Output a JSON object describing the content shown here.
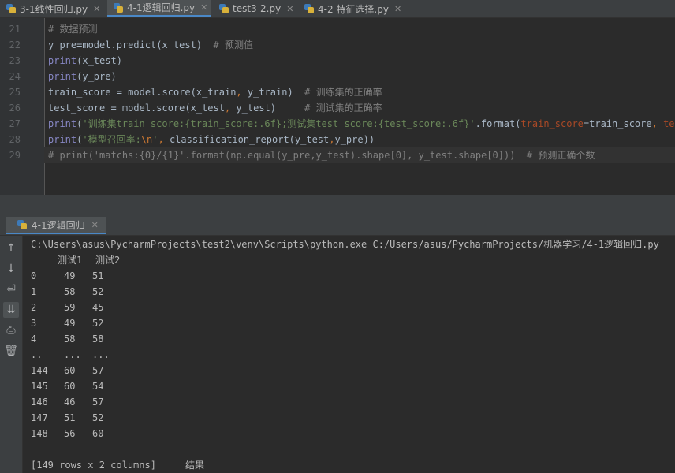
{
  "tabs": [
    {
      "label": "3-1线性回归.py",
      "active": false
    },
    {
      "label": "4-1逻辑回归.py",
      "active": true
    },
    {
      "label": "test3-2.py",
      "active": false
    },
    {
      "label": "4-2 特征选择.py",
      "active": false
    }
  ],
  "editor": {
    "current_line": 29,
    "lines": [
      {
        "num": "21",
        "parts": [
          {
            "t": "# 数据预测",
            "c": "c-comment"
          }
        ]
      },
      {
        "num": "22",
        "parts": [
          {
            "t": "y_pre=model.predict(x_test)  ",
            "c": ""
          },
          {
            "t": "# 预测值",
            "c": "c-comment"
          }
        ]
      },
      {
        "num": "23",
        "parts": [
          {
            "t": "print",
            "c": "c-kw"
          },
          {
            "t": "(x_test)",
            "c": ""
          }
        ]
      },
      {
        "num": "24",
        "parts": [
          {
            "t": "print",
            "c": "c-kw"
          },
          {
            "t": "(y_pre)",
            "c": ""
          }
        ]
      },
      {
        "num": "25",
        "parts": [
          {
            "t": "train_score = model.score(x_train",
            "c": ""
          },
          {
            "t": ", ",
            "c": "c-op"
          },
          {
            "t": "y_train)  ",
            "c": ""
          },
          {
            "t": "# 训练集的正确率",
            "c": "c-comment"
          }
        ]
      },
      {
        "num": "26",
        "parts": [
          {
            "t": "test_score = model.score(x_test",
            "c": ""
          },
          {
            "t": ", ",
            "c": "c-op"
          },
          {
            "t": "y_test)     ",
            "c": ""
          },
          {
            "t": "# 测试集的正确率",
            "c": "c-comment"
          }
        ]
      },
      {
        "num": "27",
        "parts": [
          {
            "t": "print",
            "c": "c-kw"
          },
          {
            "t": "(",
            "c": ""
          },
          {
            "t": "'训练集train score:{train_score:.6f};测试集test score:{test_score:.6f}'",
            "c": "c-str"
          },
          {
            "t": ".format(",
            "c": ""
          },
          {
            "t": "train_score",
            "c": "c-kwarg"
          },
          {
            "t": "=train_score",
            "c": ""
          },
          {
            "t": ", ",
            "c": "c-op"
          },
          {
            "t": "test_",
            "c": "c-kwarg"
          }
        ]
      },
      {
        "num": "28",
        "parts": [
          {
            "t": "print",
            "c": "c-kw"
          },
          {
            "t": "(",
            "c": ""
          },
          {
            "t": "'模型召回率:",
            "c": "c-str"
          },
          {
            "t": "\\n",
            "c": "c-esc"
          },
          {
            "t": "'",
            "c": "c-str"
          },
          {
            "t": ", ",
            "c": "c-op"
          },
          {
            "t": "classification_report(y_test",
            "c": ""
          },
          {
            "t": ",",
            "c": "c-op"
          },
          {
            "t": "y_pre))",
            "c": ""
          }
        ]
      },
      {
        "num": "29",
        "parts": [
          {
            "t": "# print('matchs:{0}/{1}'.format(np.equal(y_pre,y_test).shape[0], y_test.shape[0]))  # 预测正确个数",
            "c": "c-comment"
          }
        ]
      }
    ]
  },
  "run_panel": {
    "tab_label": "4-1逻辑回归",
    "tools": [
      "arrow-up-icon",
      "arrow-down-icon",
      "soft-wrap-icon",
      "scroll-to-end-icon",
      "print-icon",
      "trash-icon"
    ],
    "command": "C:\\Users\\asus\\PycharmProjects\\test2\\venv\\Scripts\\python.exe C:/Users/asus/PycharmProjects/机器学习/4-1逻辑回归.py",
    "columns": [
      "测试1",
      "测试2"
    ],
    "rows": [
      [
        "0",
        "49",
        "51"
      ],
      [
        "1",
        "58",
        "52"
      ],
      [
        "2",
        "59",
        "45"
      ],
      [
        "3",
        "49",
        "52"
      ],
      [
        "4",
        "58",
        "58"
      ],
      [
        "..",
        "...",
        "..."
      ],
      [
        "144",
        "60",
        "57"
      ],
      [
        "145",
        "60",
        "54"
      ],
      [
        "146",
        "46",
        "57"
      ],
      [
        "147",
        "51",
        "52"
      ],
      [
        "148",
        "56",
        "60"
      ]
    ],
    "summary": "[149 rows x 2 columns]",
    "result_label": "结果"
  }
}
